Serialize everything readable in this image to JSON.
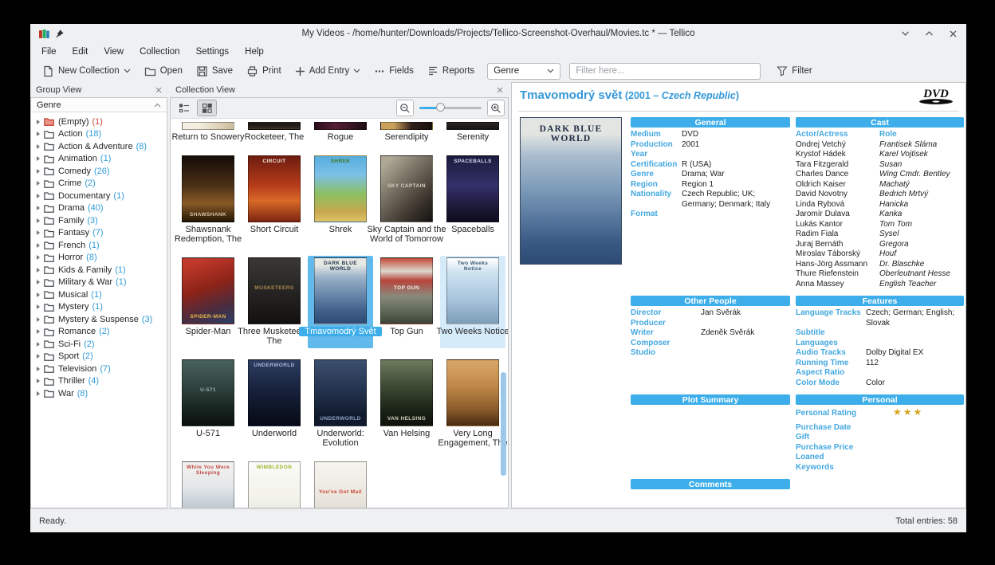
{
  "titlebar": {
    "title": "My Videos - /home/hunter/Downloads/Projects/Tellico-Screenshot-Overhaul/Movies.tc * — Tellico"
  },
  "menu": {
    "items": [
      "File",
      "Edit",
      "View",
      "Collection",
      "Settings",
      "Help"
    ]
  },
  "toolbar": {
    "new_collection": "New Collection",
    "open": "Open",
    "save": "Save",
    "print": "Print",
    "add_entry": "Add Entry",
    "fields": "Fields",
    "reports": "Reports",
    "group_combo": "Genre",
    "filter_placeholder": "Filter here...",
    "filter_button": "Filter"
  },
  "icons": {
    "app": "tellico-books",
    "pin": "pin",
    "minimize": "chevron-down",
    "maximize": "chevron-up",
    "window_close": "x",
    "new": "document",
    "open": "folder",
    "save": "floppy",
    "print": "printer",
    "add": "plus",
    "fields": "ellipsis",
    "reports": "list-lines",
    "dropdown": "chevron-down",
    "filter": "funnel",
    "panel_close": "x",
    "view_details": "list-details",
    "view_icons": "grid-squares",
    "zoom_out": "magnifier-minus",
    "zoom_in": "magnifier-plus",
    "collapse": "chevron-up",
    "expander": "triangle-right",
    "group_folder": "folder",
    "rating_star": "★"
  },
  "accent_colors": {
    "highlight": "#3daee9",
    "label_blue": "#44a8e0",
    "count_blue": "#2f9bd8",
    "star_gold": "#d7a41f",
    "empty_red": "#d04a3a"
  },
  "group_view": {
    "title": "Group View",
    "header": "Genre",
    "items": [
      {
        "label": "(Empty)",
        "count": "(1)",
        "red": true
      },
      {
        "label": "Action",
        "count": "(18)"
      },
      {
        "label": "Action & Adventure",
        "count": "(8)"
      },
      {
        "label": "Animation",
        "count": "(1)"
      },
      {
        "label": "Comedy",
        "count": "(26)"
      },
      {
        "label": "Crime",
        "count": "(2)"
      },
      {
        "label": "Documentary",
        "count": "(1)"
      },
      {
        "label": "Drama",
        "count": "(40)"
      },
      {
        "label": "Family",
        "count": "(3)"
      },
      {
        "label": "Fantasy",
        "count": "(7)"
      },
      {
        "label": "French",
        "count": "(1)"
      },
      {
        "label": "Horror",
        "count": "(8)"
      },
      {
        "label": "Kids & Family",
        "count": "(1)"
      },
      {
        "label": "Military & War",
        "count": "(1)"
      },
      {
        "label": "Musical",
        "count": "(1)"
      },
      {
        "label": "Mystery",
        "count": "(1)"
      },
      {
        "label": "Mystery & Suspense",
        "count": "(3)"
      },
      {
        "label": "Romance",
        "count": "(2)"
      },
      {
        "label": "Sci-Fi",
        "count": "(2)"
      },
      {
        "label": "Sport",
        "count": "(2)"
      },
      {
        "label": "Television",
        "count": "(7)"
      },
      {
        "label": "Thriller",
        "count": "(4)"
      },
      {
        "label": "War",
        "count": "(8)"
      }
    ]
  },
  "collection_view": {
    "title": "Collection View",
    "rows": [
      {
        "clipped": true,
        "items": [
          {
            "title": "Return to Snowery",
            "bg": "linear-gradient(100deg,#f4efe2 30%,#e3d9c2 60%,#cbbc9c)"
          },
          {
            "title": "Rocketeer, The",
            "bg": "linear-gradient(180deg,#181512,#2e2620 80%,#4a3a28)"
          },
          {
            "title": "Rogue",
            "bg": "linear-gradient(90deg,#2a0f1c,#551e35 40%,#1c0d14)"
          },
          {
            "title": "Serendipity",
            "bg": "linear-gradient(90deg,#caa15c 25%,#30201a 60%,#170f0c)"
          },
          {
            "title": "Serenity",
            "bg": "linear-gradient(180deg,#2c2824,#161412)"
          }
        ]
      },
      {
        "items": [
          {
            "title": "Shawsnank Redemption, The",
            "bg": "linear-gradient(180deg,#140d08,#4a2f16 45%,#8a5a28 72%,#241505)",
            "tx": "SHAWSHANK",
            "txc": "#d8c9a8",
            "pos": "btm"
          },
          {
            "title": "Short Circuit",
            "bg": "linear-gradient(180deg,#6e1c10,#b63c1a 45%,#d86a28 68%,#7e2410)",
            "tx": "CIRCUIT",
            "txc": "#f2e9df"
          },
          {
            "title": "Shrek",
            "bg": "linear-gradient(180deg,#57aede 0%,#7cc0e8 28%,#8cbf62 58%,#c8a84e 85%,#e0c468)",
            "tx": "SHREK",
            "txc": "#3f7a1e"
          },
          {
            "title": "Sky Captain and the World of Tomorrow",
            "bg": "linear-gradient(135deg,#b0a896 10%,#6e675a 45%,#3a342c 75%,#141210)",
            "tx": "SKY CAPTAIN",
            "txc": "#d8d2c2",
            "pos": "mid"
          },
          {
            "title": "Spaceballs",
            "bg": "linear-gradient(180deg,#1a1c3e,#34306a 45%,#1b1836 80%,#0e0c1c)",
            "tx": "SPACEBALLS",
            "txc": "#d8dcf0"
          }
        ]
      },
      {
        "items": [
          {
            "title": "Spider-Man",
            "bg": "linear-gradient(160deg,#c0392a 10%,#8e2318 45%,#4a2c3e 75%,#2c3e66)",
            "tx": "SPIDER-MAN",
            "txc": "#e8b84a",
            "pos": "btm"
          },
          {
            "title": "Three Musketeers, The",
            "bg": "linear-gradient(180deg,#3a3835,#232120 60%,#121110)",
            "tx": "MUSKETEERS",
            "txc": "#a8874a",
            "pos": "mid"
          },
          {
            "title": "Tmavomodrý Svět",
            "bg": "linear-gradient(180deg,#e6e9e4 0%,#e6e9e4 10%,#97afc8 30%,#6b89ab 55%,#41608a 80%,#2c4a74)",
            "tx": "DARK BLUE WORLD",
            "txc": "#24344a",
            "selected": true
          },
          {
            "title": "Top Gun",
            "bg": "linear-gradient(180deg,#c24a3a 0%,#ddd8cc 20%,#b8453c 34%,#8a8a7c 58%,#5c6656 82%,#3c4438)",
            "tx": "TOP GUN",
            "txc": "#f2f2ea",
            "pos": "mid"
          },
          {
            "title": "Two Weeks Notice",
            "bg": "linear-gradient(180deg,#ffffff 0%,#cfe2f0 22%,#a8c6de 62%,#7d9cb8)",
            "tx": "Two Weeks Notice",
            "txc": "#3a5a74",
            "hover": true
          }
        ]
      },
      {
        "items": [
          {
            "title": "U-571",
            "bg": "linear-gradient(180deg,#4a625c 0%,#2c3f3a 45%,#15201d 80%,#0a100e)",
            "tx": "U-571",
            "txc": "#9fb4ae",
            "pos": "mid"
          },
          {
            "title": "Underworld",
            "bg": "linear-gradient(180deg,#2e3e62 0%,#18233e 42%,#0c1222 80%,#060a14)",
            "tx": "UNDERWORLD",
            "txc": "#aab8d8"
          },
          {
            "title": "Underworld: Evolution",
            "bg": "linear-gradient(180deg,#3c4f6e 0%,#243450 45%,#101a2c 85%)",
            "tx": "UNDERWORLD",
            "txc": "#8fa6c8",
            "pos": "btm"
          },
          {
            "title": "Van Helsing",
            "bg": "linear-gradient(180deg,#6e7a5e 0%,#3c4a34 40%,#1c2418 75%,#0e120c)",
            "tx": "VAN HELSING",
            "txc": "#cfd8c0",
            "pos": "btm"
          },
          {
            "title": "Very Long Engagement, The",
            "bg": "linear-gradient(180deg,#d8a868 0%,#c08848 40%,#8a5c2c 75%,#4a2c12)"
          }
        ]
      },
      {
        "items": [
          {
            "title": "While You Were Sleeping",
            "bg": "linear-gradient(180deg,#f4f2ee 0%,#e2e6ea 40%,#b8c4cc 75%,#8a9aa6)",
            "tx": "While You Were Sleeping",
            "txc": "#c04848"
          },
          {
            "title": "Wimbledon",
            "bg": "linear-gradient(180deg,#fbfbf8 0%,#f2f2ea 55%,#dfe4d8)",
            "tx": "WIMBLEDON",
            "txc": "#9cb832"
          },
          {
            "title": "You've Got Mail",
            "bg": "linear-gradient(180deg,#f6f4f0 0%,#ece8e0 50%,#d8d2c6)",
            "tx": "You've Got Mail",
            "txc": "#cc4433",
            "pos": "mid"
          }
        ]
      }
    ]
  },
  "detail": {
    "title": "Tmavomodrý svět",
    "meta_pre": " (2001 – ",
    "country": "Czech Republic",
    "meta_close": ")",
    "logo": "DVD",
    "poster": {
      "title": "DARK BLUE WORLD",
      "bg": "linear-gradient(180deg,#e2e5e2 0%,#e2e5e2 11%,#a9bccd 26%,#7e9cba 48%,#55759c 70%,#3a5a84 85%,#2c4a74 100%)"
    },
    "general": {
      "title": "General",
      "fields": [
        {
          "l": "Medium",
          "v": "DVD"
        },
        {
          "l": "Production Year",
          "v": "2001"
        },
        {
          "l": "Certification",
          "v": "R (USA)"
        },
        {
          "l": "Genre",
          "v": "Drama; War"
        },
        {
          "l": "Region",
          "v": "Region 1"
        },
        {
          "l": "Nationality",
          "v": "Czech Republic; UK; Germany; Denmark; Italy"
        },
        {
          "l": "Format",
          "v": ""
        }
      ]
    },
    "cast": {
      "title": "Cast",
      "col1": "Actor/Actress",
      "col2": "Role",
      "rows": [
        [
          "Ondrej Vetchý",
          "Frantisek Sláma"
        ],
        [
          "Krystof Hádek",
          "Karel Vojtisek"
        ],
        [
          "Tara Fitzgerald",
          "Susan"
        ],
        [
          "Charles Dance",
          "Wing Cmdr. Bentley"
        ],
        [
          "Oldrich Kaiser",
          "Machatý"
        ],
        [
          "David Novotny",
          "Bedrich Mrtvý"
        ],
        [
          "Linda Rybová",
          "Hanicka"
        ],
        [
          "Jaromír Dulava",
          "Kanka"
        ],
        [
          "Lukás Kantor",
          "Tom Tom"
        ],
        [
          "Radim Fiala",
          "Sysel"
        ],
        [
          "Juraj Bernáth",
          "Gregora"
        ],
        [
          "Miroslav Táborský",
          "Houf"
        ],
        [
          "Hans-Jörg Assmann",
          "Dr. Blaschke"
        ],
        [
          "Thure Riefenstein",
          "Oberleutnant Hesse"
        ],
        [
          "Anna Massey",
          "English Teacher"
        ]
      ]
    },
    "other_people": {
      "title": "Other People",
      "fields": [
        {
          "l": "Director",
          "v": "Jan Svěrák"
        },
        {
          "l": "Producer",
          "v": ""
        },
        {
          "l": "Writer",
          "v": "Zdeněk Svěrák"
        },
        {
          "l": "Composer",
          "v": ""
        },
        {
          "l": "Studio",
          "v": ""
        }
      ]
    },
    "features": {
      "title": "Features",
      "fields": [
        {
          "l": "Language Tracks",
          "v": "Czech; German; English; Slovak"
        },
        {
          "l": "Subtitle Languages",
          "v": ""
        },
        {
          "l": "Audio Tracks",
          "v": "Dolby Digital EX"
        },
        {
          "l": "Running Time",
          "v": "112"
        },
        {
          "l": "Aspect Ratio",
          "v": ""
        },
        {
          "l": "Color Mode",
          "v": "Color"
        }
      ]
    },
    "plot": {
      "title": "Plot Summary"
    },
    "personal": {
      "title": "Personal",
      "fields": [
        {
          "l": "Personal Rating",
          "v": "★★★",
          "stars": true,
          "gap": true
        },
        {
          "l": "Purchase Date",
          "v": ""
        },
        {
          "l": "Gift",
          "v": ""
        },
        {
          "l": "Purchase Price",
          "v": ""
        },
        {
          "l": "Loaned",
          "v": ""
        },
        {
          "l": "Keywords",
          "v": ""
        }
      ]
    },
    "comments": {
      "title": "Comments"
    }
  },
  "status": {
    "left": "Ready.",
    "right": "Total entries: 58"
  }
}
